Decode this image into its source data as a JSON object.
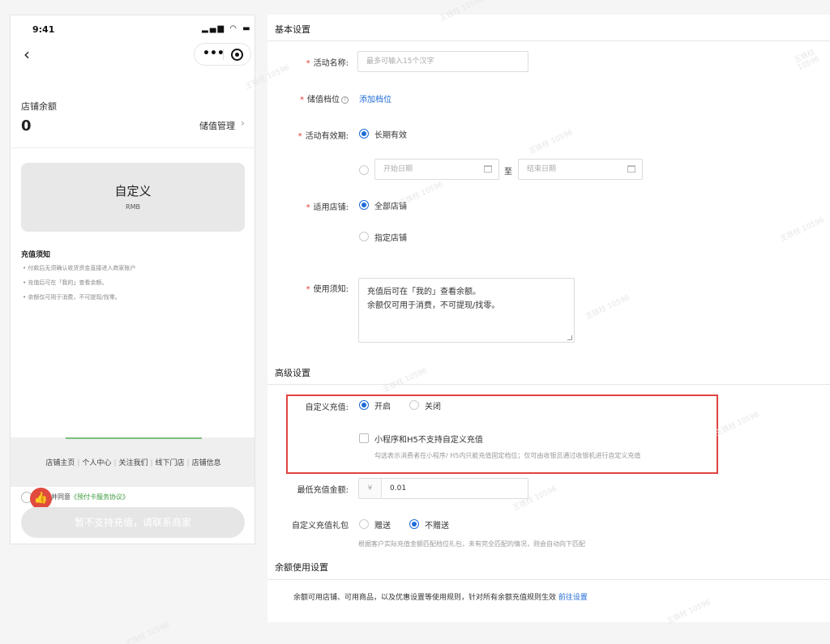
{
  "phone": {
    "time": "9:41",
    "status_icons": "▂▄▆ ◠ ▬",
    "back_icon": "‹",
    "capsule_more": "•••",
    "balance_label": "店铺余额",
    "balance_value": "0",
    "manage_label": "储值管理",
    "manage_chevron": "›",
    "custom_title": "自定义",
    "custom_unit": "RMB",
    "notice_title": "充值须知",
    "notice_items": [
      "• 付款后无须确认收货资金直接进入商家账户",
      "• 充值后可在「我的」查看余额。",
      "• 余额仅可用于消费，不可提现/找零。"
    ],
    "tabs": [
      "店铺主页",
      "个人中心",
      "关注我们",
      "线下门店",
      "店铺信息"
    ],
    "agree_prefix": "并同意",
    "agree_link": "《预付卡服务协议》",
    "thumb_icon": "👍",
    "pay_button": "暂不支持充值，请联系商家"
  },
  "form": {
    "basic_title": "基本设置",
    "name_label": "活动名称:",
    "name_placeholder": "最多可输入15个汉字",
    "tier_label": "储值档位",
    "tier_help": "?",
    "tier_link": "添加档位",
    "validity_label": "活动有效期:",
    "validity_long": "长期有效",
    "start_placeholder": "开始日期",
    "to_label": "至",
    "end_placeholder": "结束日期",
    "store_label": "适用店铺:",
    "store_all": "全部店铺",
    "store_specific": "指定店铺",
    "usage_label": "使用须知:",
    "usage_lines": [
      "充值后可在「我的」查看余额。",
      "余额仅可用于消费，不可提现/找零。"
    ],
    "advanced_title": "高级设置",
    "custom_label": "自定义充值:",
    "custom_on": "开启",
    "custom_off": "关闭",
    "custom_checkbox": "小程序和H5不支持自定义充值",
    "custom_hint": "勾选表示消费者在小程序/ H5内只能充值固定档位；仅可由收银员通过收银机进行自定义充值",
    "min_label": "最低充值金额:",
    "min_prefix": "¥",
    "min_value": "0.01",
    "gift_label": "自定义充值礼包",
    "gift_yes": "赠送",
    "gift_no": "不赠送",
    "gift_hint": "根据客户实际充值金额匹配档位礼包，未有完全匹配的情况，则会自动向下匹配",
    "balance_title": "余额使用设置",
    "balance_text": "余额可用店铺、可用商品，以及优惠设置等使用规则，针对所有余额充值规则生效",
    "balance_link": "前往设置"
  },
  "watermark": "王铁柱 10596",
  "colors": {
    "accent": "#1e6bd6",
    "required": "#e5392e",
    "highlight": "#e0443f",
    "agree_link": "#3c9a3c"
  }
}
